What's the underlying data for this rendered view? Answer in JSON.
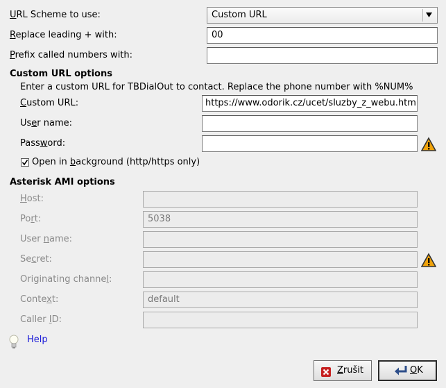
{
  "general": {
    "scheme_label": "URL Scheme to use:",
    "scheme_value": "Custom URL",
    "replace_label": "Replace leading + with:",
    "replace_value": "00",
    "prefix_label": "Prefix called numbers with:",
    "prefix_value": ""
  },
  "custom_url": {
    "section_title": "Custom URL options",
    "description": "Enter a custom URL for TBDialOut to contact. Replace the phone number with %NUM%",
    "url_label": "Custom URL:",
    "url_value": "https://www.odorik.cz/ucet/sluzby_z_webu.html?",
    "user_label": "User name:",
    "user_value": "",
    "password_label": "Password:",
    "password_value": "",
    "background_label": "Open in background (http/https only)",
    "background_checked": true
  },
  "ami": {
    "section_title": "Asterisk AMI options",
    "host_label": "Host:",
    "host_value": "",
    "port_label": "Port:",
    "port_value": "5038",
    "user_label": "User name:",
    "user_value": "",
    "secret_label": "Secret:",
    "secret_value": "",
    "channel_label": "Originating channel:",
    "channel_value": "",
    "context_label": "Context:",
    "context_value": "default",
    "callerid_label": "Caller ID:",
    "callerid_value": ""
  },
  "help": {
    "label": "Help",
    "icon": "lightbulb-icon"
  },
  "buttons": {
    "cancel_label": "Zrušit",
    "ok_label": "OK"
  },
  "colors": {
    "link": "#1a1ad8",
    "warning": "#f0a30a",
    "dialog_bg": "#efefef"
  }
}
